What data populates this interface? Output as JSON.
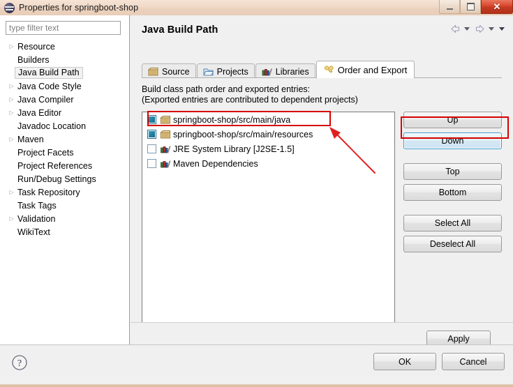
{
  "window": {
    "title": "Properties for springboot-shop",
    "icon": "eclipse-icon",
    "minimize_label": "",
    "maximize_label": "",
    "close_label": "✕"
  },
  "sidebar": {
    "filter": {
      "placeholder": "type filter text",
      "value": ""
    },
    "items": [
      {
        "label": "Resource",
        "expandable": true,
        "selected": false
      },
      {
        "label": "Builders",
        "expandable": false,
        "selected": false
      },
      {
        "label": "Java Build Path",
        "expandable": false,
        "selected": true
      },
      {
        "label": "Java Code Style",
        "expandable": true,
        "selected": false
      },
      {
        "label": "Java Compiler",
        "expandable": true,
        "selected": false
      },
      {
        "label": "Java Editor",
        "expandable": true,
        "selected": false
      },
      {
        "label": "Javadoc Location",
        "expandable": false,
        "selected": false
      },
      {
        "label": "Maven",
        "expandable": true,
        "selected": false
      },
      {
        "label": "Project Facets",
        "expandable": false,
        "selected": false
      },
      {
        "label": "Project References",
        "expandable": false,
        "selected": false
      },
      {
        "label": "Run/Debug Settings",
        "expandable": false,
        "selected": false
      },
      {
        "label": "Task Repository",
        "expandable": true,
        "selected": false
      },
      {
        "label": "Task Tags",
        "expandable": false,
        "selected": false
      },
      {
        "label": "Validation",
        "expandable": true,
        "selected": false
      },
      {
        "label": "WikiText",
        "expandable": false,
        "selected": false
      }
    ]
  },
  "main": {
    "page_title": "Java Build Path",
    "nav": {
      "back_icon": "back-arrow-icon",
      "back_dropdown_icon": "chevron-down-icon",
      "forward_icon": "forward-arrow-icon",
      "forward_dropdown_icon": "chevron-down-icon",
      "menu_dropdown_icon": "chevron-down-icon"
    },
    "tabs": [
      {
        "label": "Source",
        "icon": "source-folder-icon",
        "active": false
      },
      {
        "label": "Projects",
        "icon": "projects-folder-icon",
        "active": false
      },
      {
        "label": "Libraries",
        "icon": "libraries-books-icon",
        "active": false
      },
      {
        "label": "Order and Export",
        "icon": "order-export-key-icon",
        "active": true
      }
    ],
    "description_line1": "Build class path order and exported entries:",
    "description_line2": "(Exported entries are contributed to dependent projects)",
    "entries": [
      {
        "label": "springboot-shop/src/main/java",
        "checked": true,
        "icon": "source-folder-icon"
      },
      {
        "label": "springboot-shop/src/main/resources",
        "checked": true,
        "icon": "source-folder-icon"
      },
      {
        "label": "JRE System Library [J2SE-1.5]",
        "checked": false,
        "icon": "library-icon"
      },
      {
        "label": "Maven Dependencies",
        "checked": false,
        "icon": "library-icon"
      }
    ],
    "side_buttons": [
      {
        "label": "Up",
        "focused": false
      },
      {
        "label": "Down",
        "focused": true
      },
      {
        "label": "Top",
        "focused": false
      },
      {
        "label": "Bottom",
        "focused": false
      },
      {
        "label": "Select All",
        "focused": false
      },
      {
        "label": "Deselect All",
        "focused": false
      }
    ],
    "apply_label": "Apply"
  },
  "footer": {
    "help_icon": "help-question-icon",
    "ok_label": "OK",
    "cancel_label": "Cancel"
  },
  "annotations": {
    "highlight_color": "#d60000",
    "rects": [
      {
        "name": "resources-entry-highlight"
      },
      {
        "name": "down-button-highlight"
      }
    ],
    "arrow": {
      "name": "pointer-arrow"
    }
  },
  "colors": {
    "accent_focus": "#3c9cd0",
    "checkbox_checked": "#1f7f9e",
    "annotation": "#d60000",
    "titlebar": "#f0d9c8"
  }
}
